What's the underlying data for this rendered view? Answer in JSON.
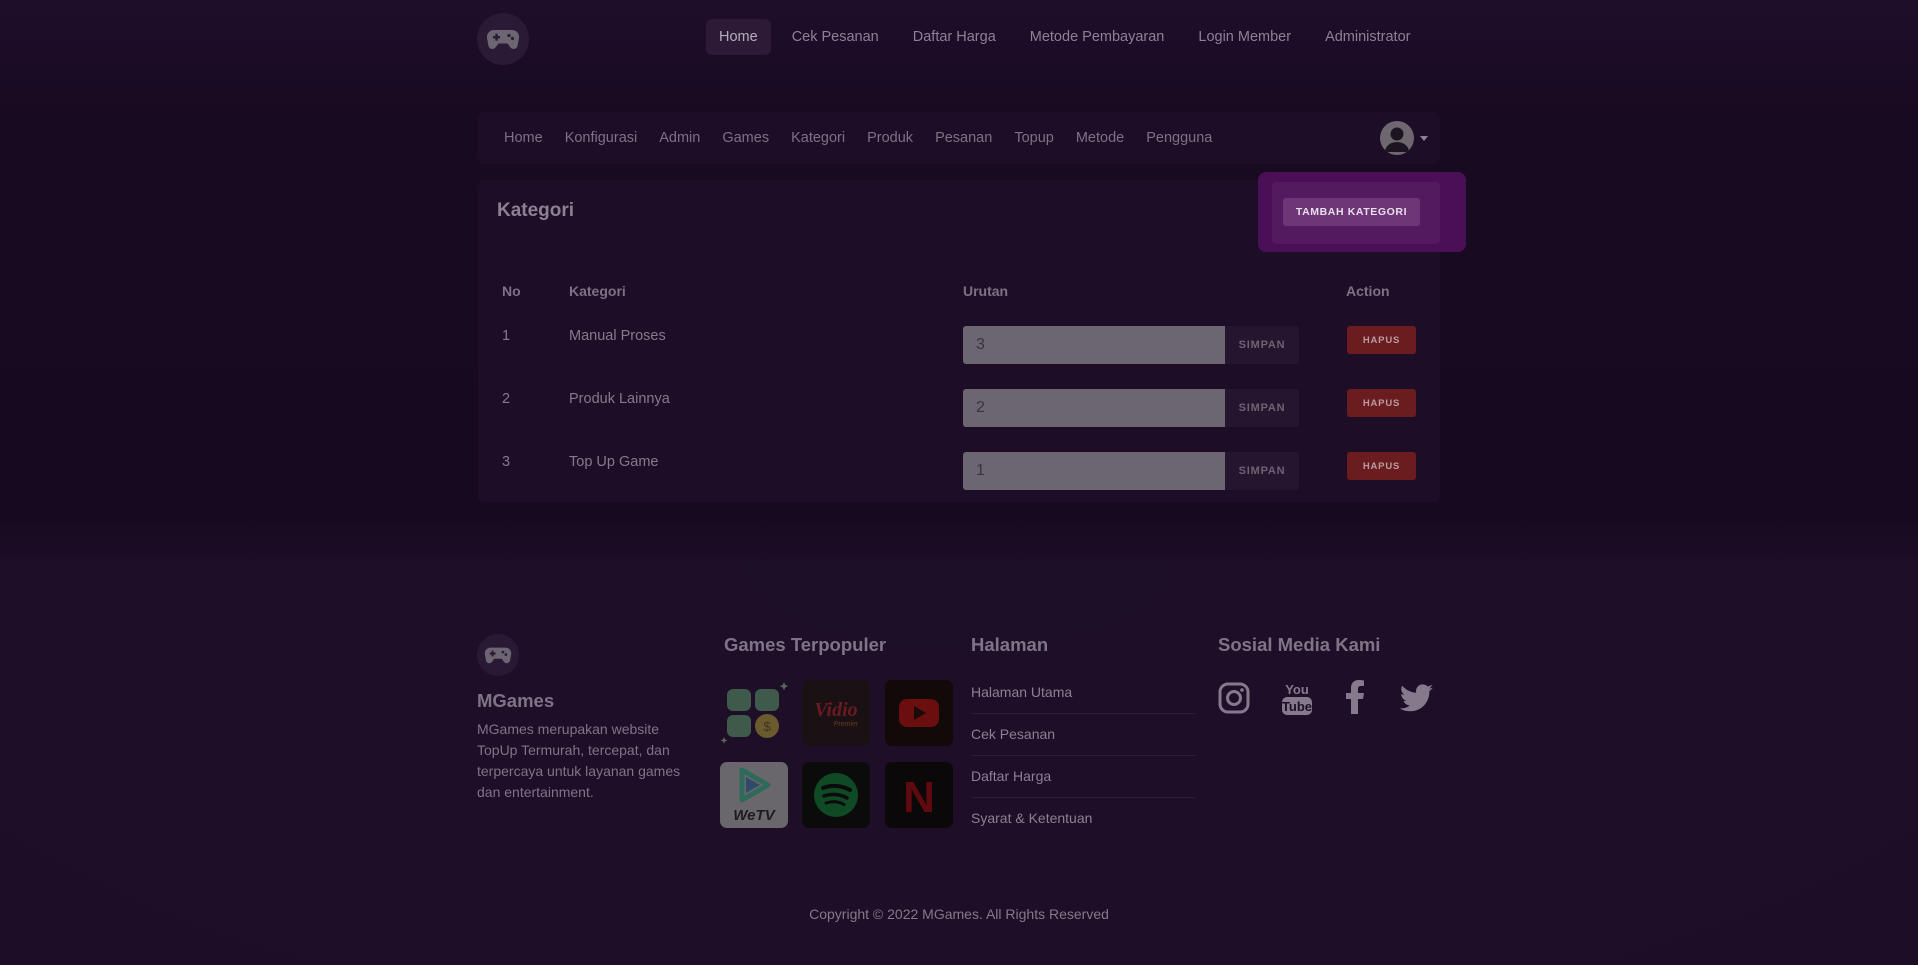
{
  "topnav": {
    "items": [
      "Home",
      "Cek Pesanan",
      "Daftar Harga",
      "Metode Pembayaran",
      "Login Member",
      "Administrator"
    ],
    "active": "Home"
  },
  "adminnav": {
    "items": [
      "Home",
      "Konfigurasi",
      "Admin",
      "Games",
      "Kategori",
      "Produk",
      "Pesanan",
      "Topup",
      "Metode",
      "Pengguna"
    ]
  },
  "category": {
    "title": "Kategori",
    "add_button": "TAMBAH KATEGORI",
    "headers": {
      "no": "No",
      "kategori": "Kategori",
      "urutan": "Urutan",
      "action": "Action"
    },
    "rows": [
      {
        "no": "1",
        "name": "Manual Proses",
        "order": "3"
      },
      {
        "no": "2",
        "name": "Produk Lainnya",
        "order": "2"
      },
      {
        "no": "3",
        "name": "Top Up Game",
        "order": "1"
      }
    ],
    "save_label": "SIMPAN",
    "delete_label": "HAPUS"
  },
  "footer": {
    "brand": "MGames",
    "description": "MGames merupakan website TopUp Termurah, tercepat, dan terpercaya untuk layanan games dan entertainment.",
    "games_title": "Games Terpopuler",
    "games": [
      {
        "icon": "apps-grid-icon",
        "label": ""
      },
      {
        "icon": "vidio-icon",
        "label": "Vidio"
      },
      {
        "icon": "youtube-icon",
        "label": ""
      },
      {
        "icon": "wetv-icon",
        "label": "WeTV"
      },
      {
        "icon": "spotify-icon",
        "label": ""
      },
      {
        "icon": "netflix-icon",
        "label": "N"
      }
    ],
    "pages_title": "Halaman",
    "pages": [
      "Halaman Utama",
      "Cek Pesanan",
      "Daftar Harga",
      "Syarat & Ketentuan"
    ],
    "social_title": "Sosial Media Kami",
    "social": [
      "instagram-icon",
      "youtube-icon",
      "facebook-icon",
      "twitter-icon"
    ],
    "copyright": "Copyright © 2022 MGames. All Rights Reserved"
  }
}
